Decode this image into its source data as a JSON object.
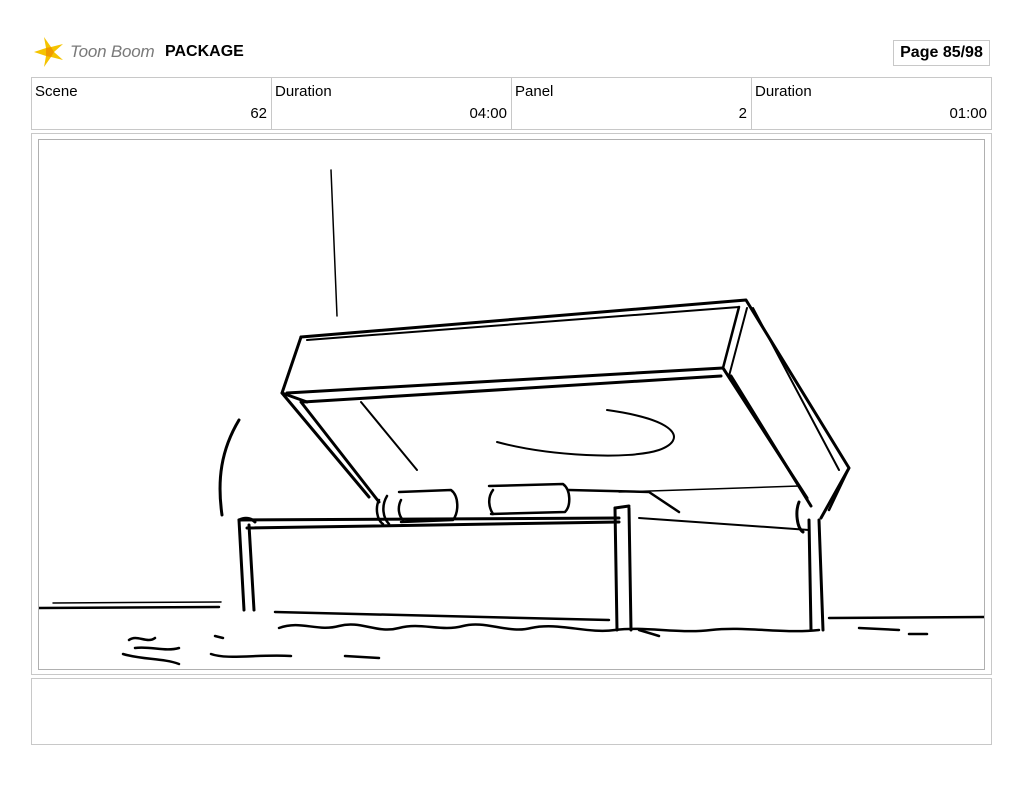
{
  "header": {
    "logo_text": "Toon Boom",
    "project_name": "PACKAGE",
    "page": "Page 85/98"
  },
  "info": {
    "scene_label": "Scene",
    "scene_value": "62",
    "scene_duration_label": "Duration",
    "scene_duration_value": "04:00",
    "panel_label": "Panel",
    "panel_value": "2",
    "panel_duration_label": "Duration",
    "panel_duration_value": "01:00"
  },
  "panel_image": {
    "subject": "open-chest-sketch",
    "icon": "sketch-drawing"
  },
  "notes": {
    "text": ""
  }
}
